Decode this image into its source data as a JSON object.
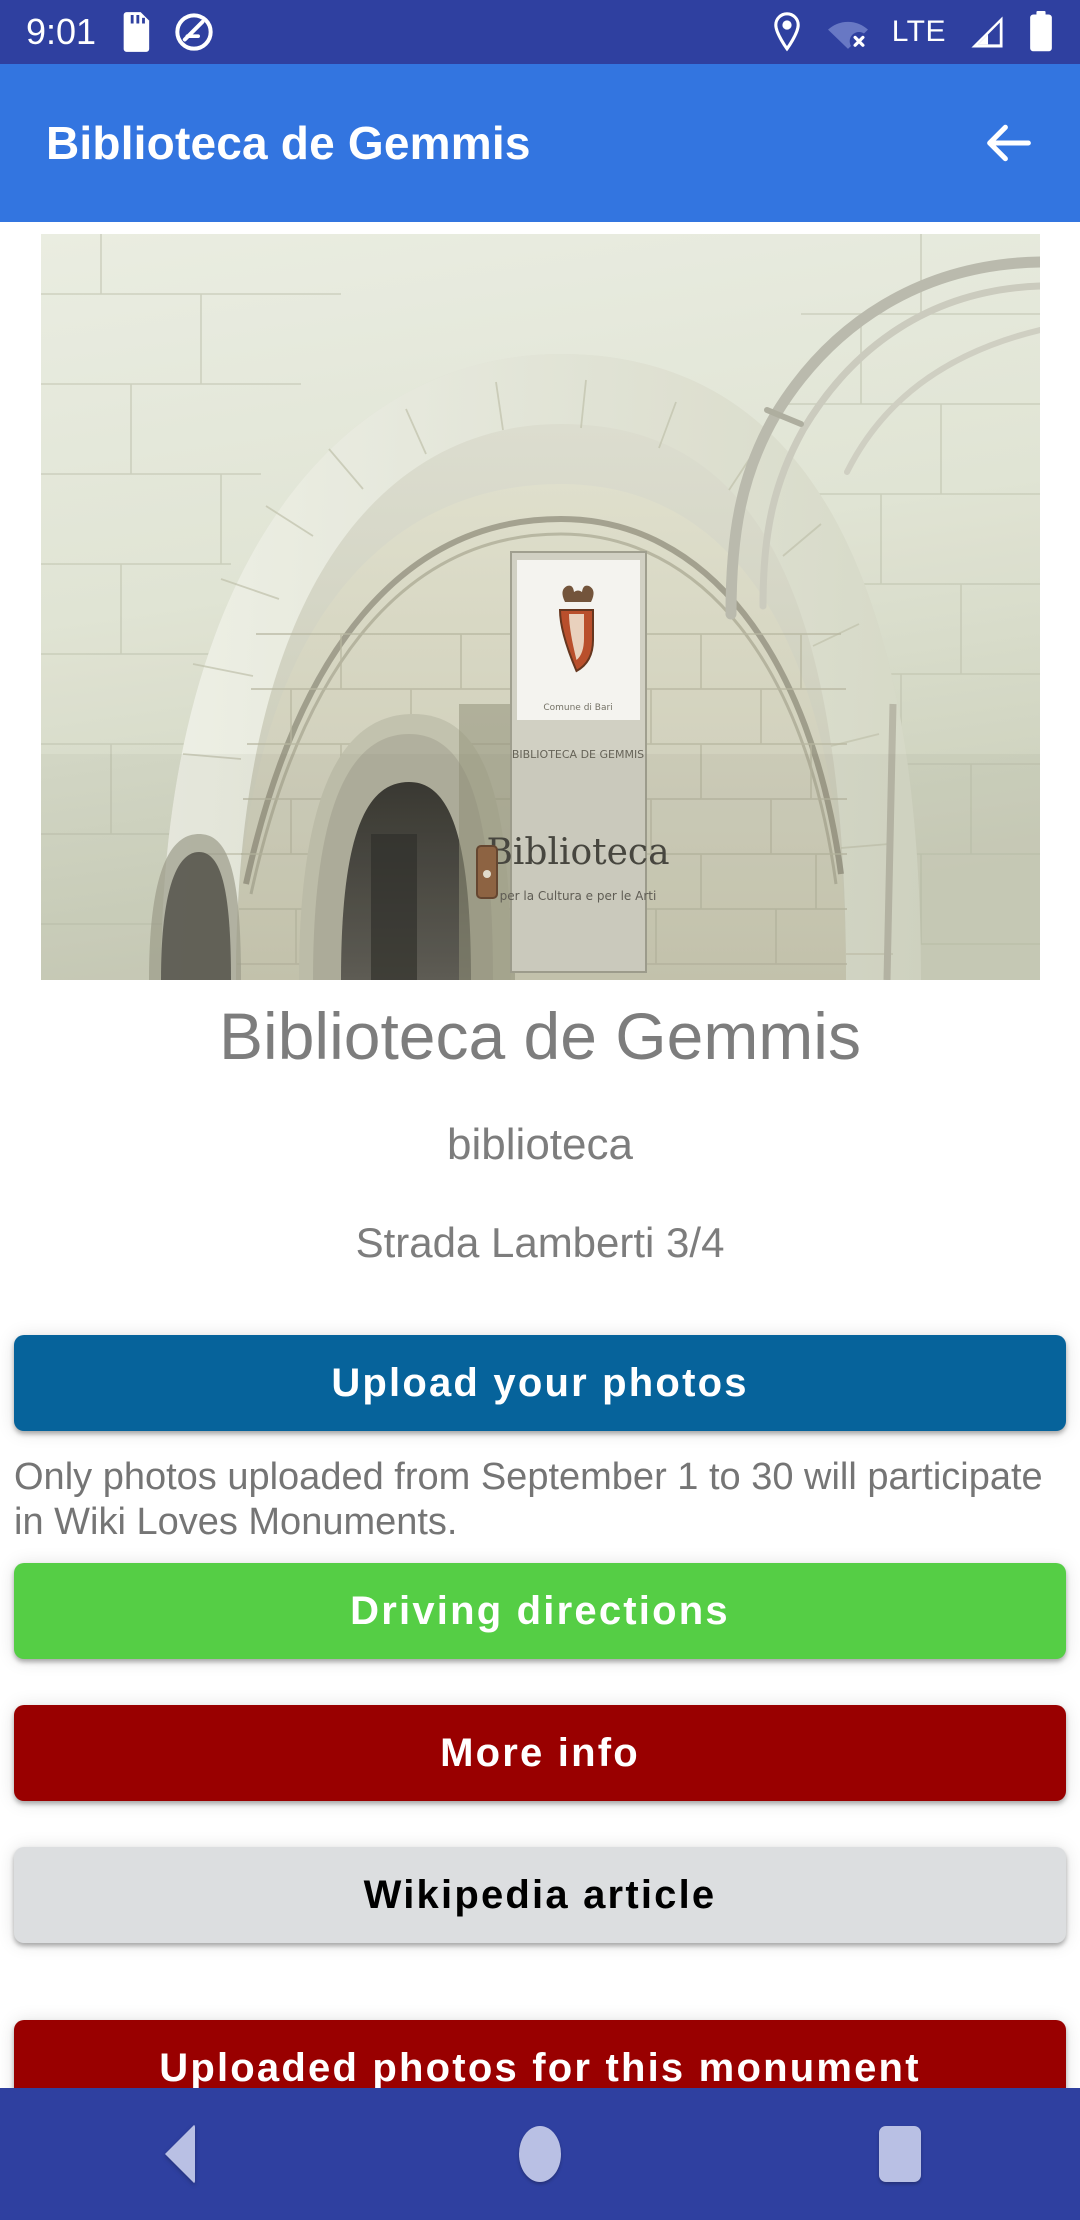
{
  "status_bar": {
    "time": "9:01",
    "background_color": "#2F40A0",
    "icons": [
      {
        "name": "sd-card-icon",
        "position": "left"
      },
      {
        "name": "do-not-disturb-icon",
        "position": "left"
      },
      {
        "name": "location-pin-icon",
        "position": "right"
      },
      {
        "name": "wifi-off-icon",
        "position": "right"
      },
      {
        "name": "signal-bars-icon",
        "position": "right"
      },
      {
        "name": "battery-full-icon",
        "position": "right"
      }
    ],
    "network_label": "LTE"
  },
  "app_bar": {
    "title": "Biblioteca de Gemmis",
    "background_color": "#3375E0",
    "back_icon": "arrow-left-icon"
  },
  "monument": {
    "photo_alt": "Stone arch entrance of the Biblioteca de Gemmis with a wall plaque reading Biblioteca",
    "name": "Biblioteca de Gemmis",
    "type": "biblioteca",
    "address": "Strada Lamberti 3/4"
  },
  "actions": {
    "upload": {
      "label": "Upload your photos",
      "color": "#06639B",
      "text_color": "#FFFFFF"
    },
    "note": "Only photos uploaded from September 1 to 30 will participate in Wiki Loves Monuments.",
    "directions": {
      "label": "Driving directions",
      "color": "#55CE45",
      "text_color": "#FFFFFF"
    },
    "more_info": {
      "label": "More info",
      "color": "#990000",
      "text_color": "#FFFFFF"
    },
    "wikipedia": {
      "label": "Wikipedia article",
      "color": "#DCDEE0",
      "text_color": "#000000"
    },
    "uploaded_photos": {
      "label": "Uploaded photos for this monument",
      "color": "#990000",
      "text_color": "#FFFFFF"
    }
  },
  "nav_bar": {
    "background_color": "#2F40A0",
    "back_label": "Back",
    "home_label": "Home",
    "recents_label": "Recents"
  }
}
